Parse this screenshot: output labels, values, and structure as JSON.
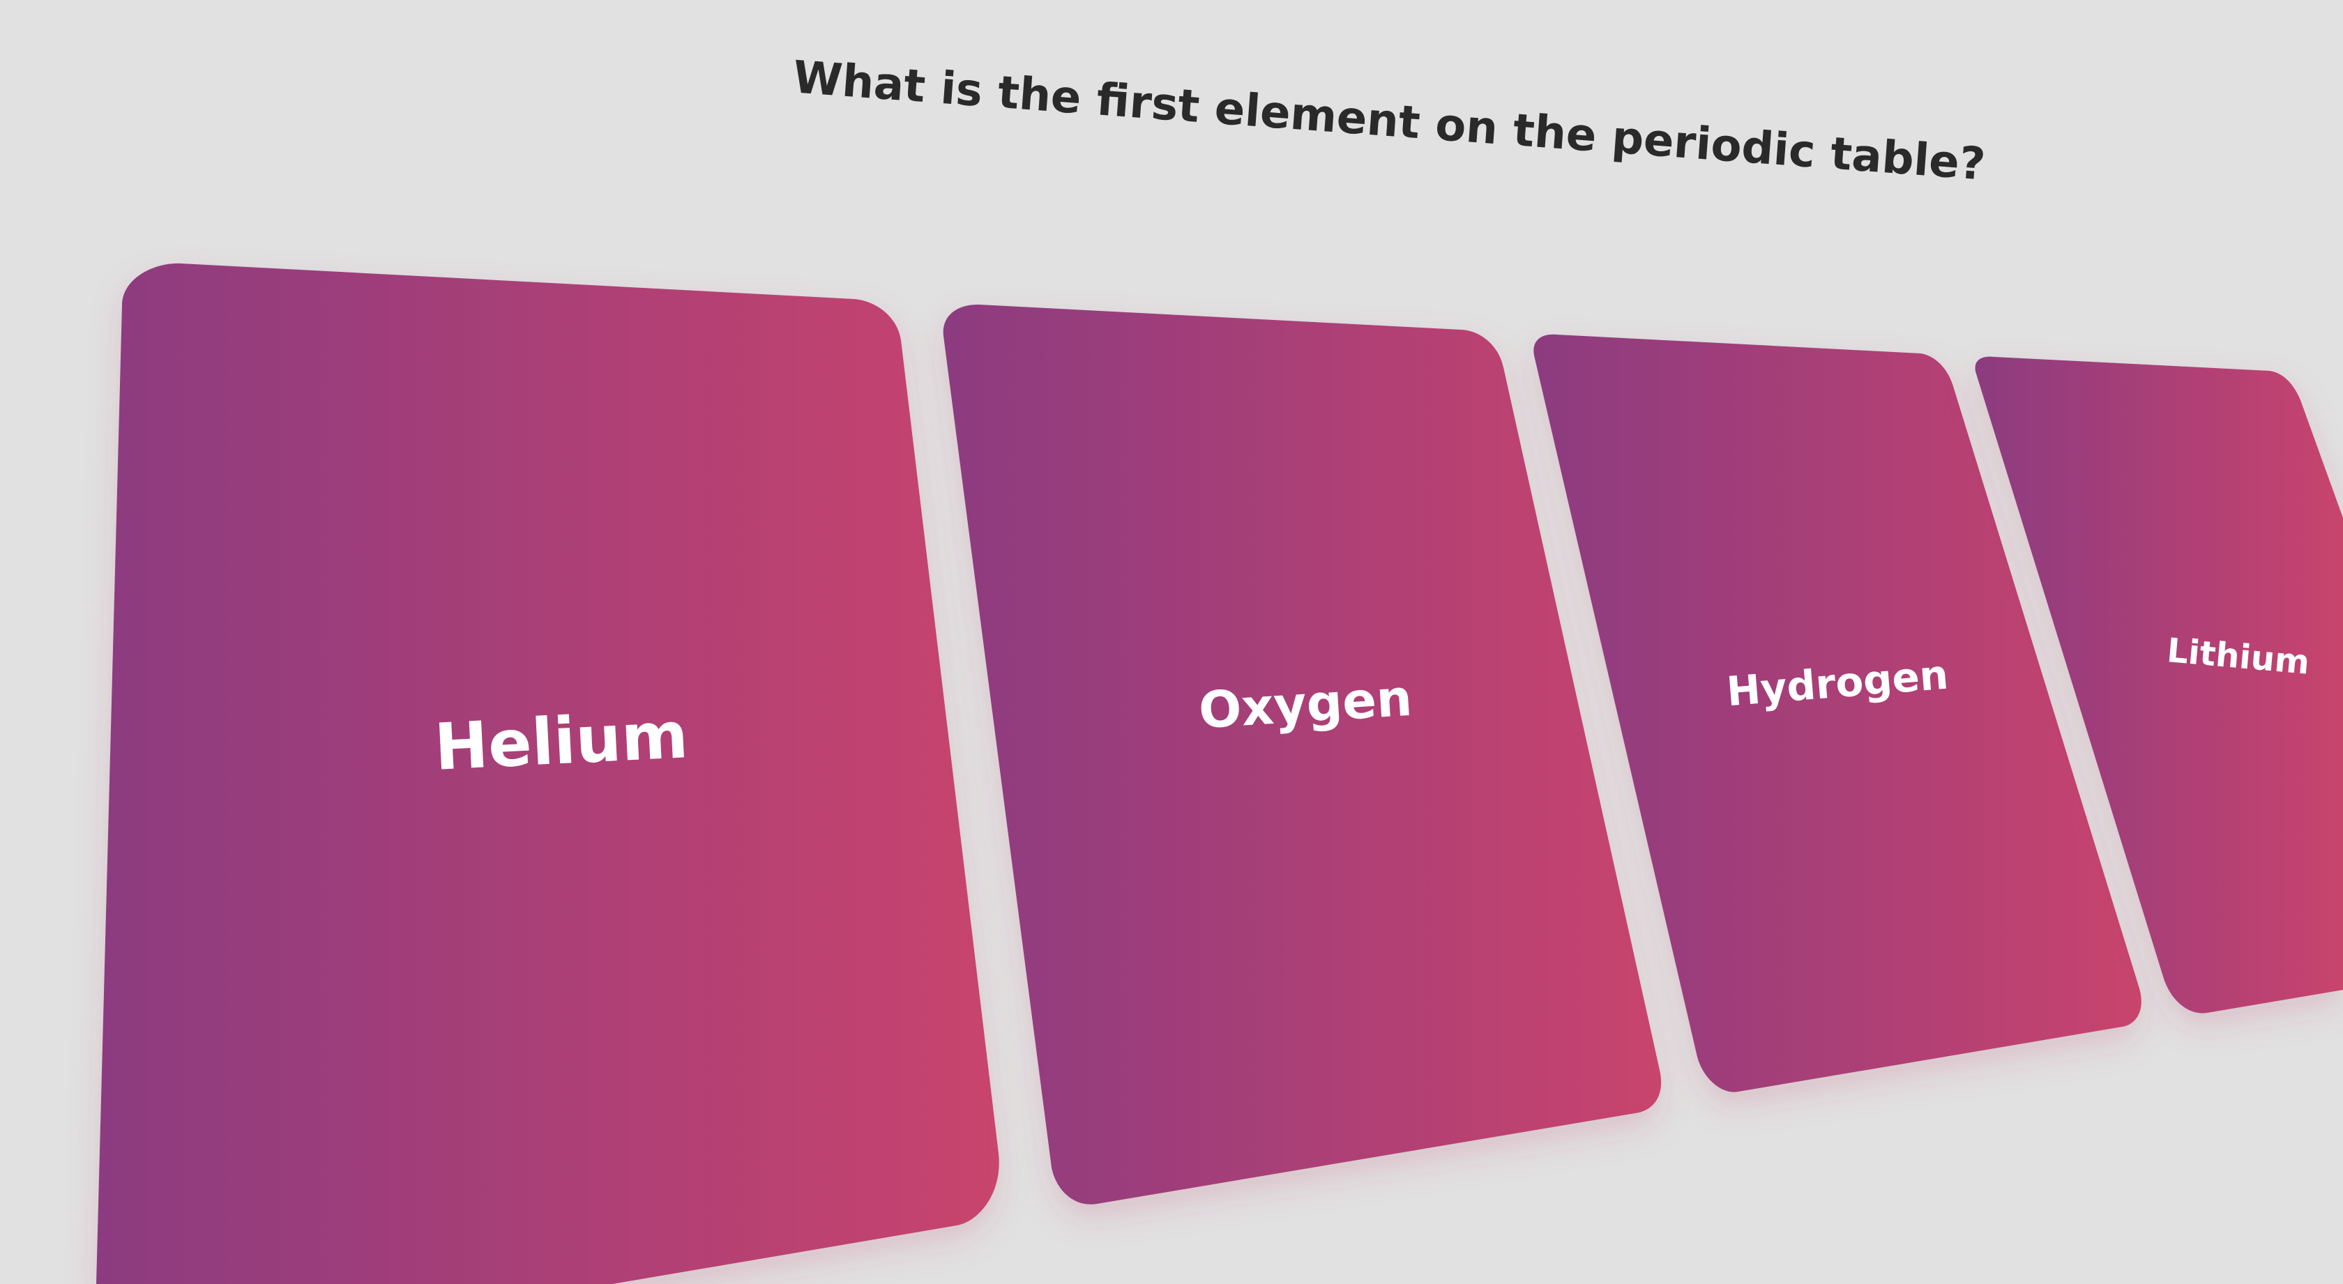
{
  "quiz": {
    "question": "What is the first element on the periodic table?",
    "answers": [
      {
        "label": "Helium"
      },
      {
        "label": "Oxygen"
      },
      {
        "label": "Hydrogen"
      },
      {
        "label": "Lithium"
      }
    ]
  },
  "colors": {
    "background": "#e1e1e1",
    "question_text": "#2a2a2a",
    "card_gradient_start": "#8c3b80",
    "card_gradient_end": "#c8446d",
    "card_text": "#ffffff"
  }
}
